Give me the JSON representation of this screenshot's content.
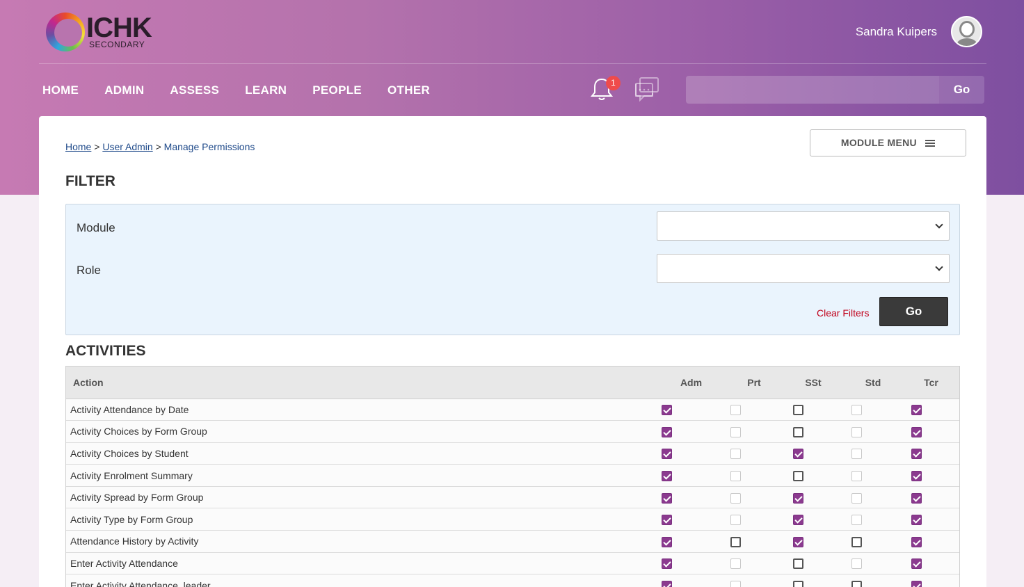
{
  "brand": {
    "name": "ICHK",
    "sub": "SECONDARY"
  },
  "user": {
    "name": "Sandra Kuipers"
  },
  "nav": [
    "HOME",
    "ADMIN",
    "ASSESS",
    "LEARN",
    "PEOPLE",
    "OTHER"
  ],
  "notifications": {
    "count": "1"
  },
  "search": {
    "value": "",
    "button": "Go"
  },
  "breadcrumb": {
    "home": "Home",
    "sep": ">",
    "user_admin": "User Admin",
    "current": "Manage Permissions"
  },
  "module_menu": {
    "label": "MODULE MENU"
  },
  "filter": {
    "title": "FILTER",
    "module_label": "Module",
    "module_value": "",
    "role_label": "Role",
    "role_value": "",
    "clear_label": "Clear Filters",
    "go_label": "Go"
  },
  "activities": {
    "title": "ACTIVITIES",
    "columns": [
      "Action",
      "Adm",
      "Prt",
      "SSt",
      "Std",
      "Tcr"
    ],
    "rows": [
      {
        "action": "Activity Attendance by Date",
        "perms": [
          "on",
          "dis",
          "off",
          "dis",
          "on"
        ]
      },
      {
        "action": "Activity Choices by Form Group",
        "perms": [
          "on",
          "dis",
          "off",
          "dis",
          "on"
        ]
      },
      {
        "action": "Activity Choices by Student",
        "perms": [
          "on",
          "dis",
          "on",
          "dis",
          "on"
        ]
      },
      {
        "action": "Activity Enrolment Summary",
        "perms": [
          "on",
          "dis",
          "off",
          "dis",
          "on"
        ]
      },
      {
        "action": "Activity Spread by Form Group",
        "perms": [
          "on",
          "dis",
          "on",
          "dis",
          "on"
        ]
      },
      {
        "action": "Activity Type by Form Group",
        "perms": [
          "on",
          "dis",
          "on",
          "dis",
          "on"
        ]
      },
      {
        "action": "Attendance History by Activity",
        "perms": [
          "on",
          "off",
          "on",
          "off",
          "on"
        ]
      },
      {
        "action": "Enter Activity Attendance",
        "perms": [
          "on",
          "dis",
          "off",
          "dis",
          "on"
        ]
      },
      {
        "action": "Enter Activity Attendance_leader",
        "perms": [
          "on",
          "dis",
          "off",
          "off",
          "on"
        ]
      }
    ]
  }
}
